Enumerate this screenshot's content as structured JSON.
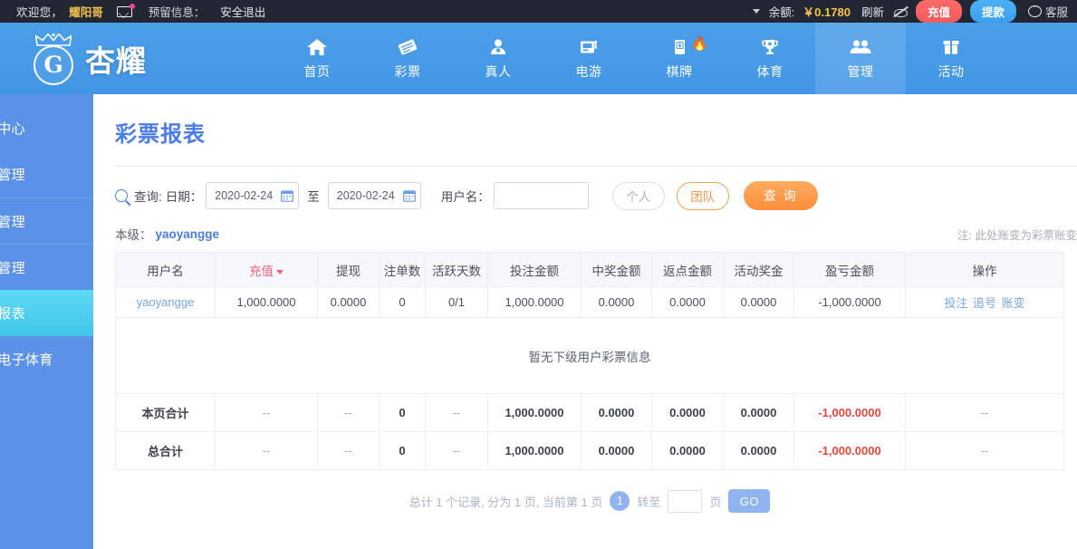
{
  "topbar": {
    "welcome": "欢迎您，",
    "user_name": "耀阳哥",
    "mail_icon": "mail-icon",
    "reserve_label": "预留信息：",
    "logout": "安全退出",
    "balance_label": "余额:",
    "balance_value": "￥0.1780",
    "refresh": "刷新",
    "eye_icon": "eye-off-icon",
    "recharge": "充值",
    "withdraw": "提款",
    "service": "客服",
    "accent_gold": "#f5c542",
    "accent_red": "#f35b5b",
    "accent_blue": "#3aa0ef"
  },
  "brand": {
    "logo_text": "杏耀",
    "logo_letter": "G"
  },
  "nav": {
    "items": [
      {
        "label": "首页",
        "icon": "home-icon",
        "active": false
      },
      {
        "label": "彩票",
        "icon": "ticket-icon",
        "active": false
      },
      {
        "label": "真人",
        "icon": "person-icon",
        "active": false
      },
      {
        "label": "电游",
        "icon": "slot-machine-icon",
        "active": false
      },
      {
        "label": "棋牌",
        "icon": "mahjong-tile-icon",
        "active": false,
        "badge": "fire-icon"
      },
      {
        "label": "体育",
        "icon": "trophy-icon",
        "active": false
      },
      {
        "label": "管理",
        "icon": "users-icon",
        "active": true
      },
      {
        "label": "活动",
        "icon": "gift-icon",
        "active": false
      }
    ]
  },
  "sidebar": {
    "items": [
      {
        "label": "理中心",
        "active": false,
        "divider": false
      },
      {
        "label": "人管理",
        "active": false,
        "divider": false
      },
      {
        "label": "人管理",
        "active": false,
        "divider": true
      },
      {
        "label": "表管理",
        "active": false,
        "divider": true
      },
      {
        "label": "票报表",
        "active": true,
        "divider": false
      },
      {
        "label": "人电子体育",
        "active": false,
        "divider": false
      }
    ]
  },
  "page": {
    "title": "彩票报表"
  },
  "filter": {
    "search_icon": "search-icon",
    "query_label": "查询:",
    "date_label": "日期：",
    "date_from": "2020-02-24",
    "date_to": "2020-02-24",
    "between": "至",
    "calendar_icon": "calendar-icon",
    "username_label": "用户名：",
    "username_value": "",
    "username_placeholder": "",
    "personal_btn": "个人",
    "team_btn": "团队",
    "query_btn": "查 询"
  },
  "level": {
    "label": "本级：",
    "value": "yaoyangge",
    "note": "注: 此处账变为彩票账变"
  },
  "table": {
    "headers": [
      {
        "label": "用户名",
        "sorted": false
      },
      {
        "label": "充值",
        "sorted": true
      },
      {
        "label": "提现",
        "sorted": false
      },
      {
        "label": "注单数",
        "sorted": false
      },
      {
        "label": "活跃天数",
        "sorted": false
      },
      {
        "label": "投注金额",
        "sorted": false
      },
      {
        "label": "中奖金额",
        "sorted": false
      },
      {
        "label": "返点金额",
        "sorted": false
      },
      {
        "label": "活动奖金",
        "sorted": false
      },
      {
        "label": "盈亏金额",
        "sorted": false
      },
      {
        "label": "操作",
        "sorted": false
      }
    ],
    "rows": [
      {
        "username": "yaoyangge",
        "recharge": "1,000.0000",
        "withdraw": "0.0000",
        "bet_count": "0",
        "active_days": "0/1",
        "bet_amount": "1,000.0000",
        "win_amount": "0.0000",
        "rebate": "0.0000",
        "bonus": "0.0000",
        "profit": "-1,000.0000",
        "ops": [
          "投注",
          "追号",
          "账变"
        ]
      }
    ],
    "empty_text": "暂无下级用户彩票信息",
    "summary": [
      {
        "label": "本页合计",
        "recharge": "--",
        "withdraw": "--",
        "bet_count": "0",
        "active_days": "--",
        "bet_amount": "1,000.0000",
        "win_amount": "0.0000",
        "rebate": "0.0000",
        "bonus": "0.0000",
        "profit": "-1,000.0000",
        "ops": "--"
      },
      {
        "label": "总合计",
        "recharge": "--",
        "withdraw": "--",
        "bet_count": "0",
        "active_days": "--",
        "bet_amount": "1,000.0000",
        "win_amount": "0.0000",
        "rebate": "0.0000",
        "bonus": "0.0000",
        "profit": "-1,000.0000",
        "ops": "--"
      }
    ]
  },
  "pager": {
    "summary": "总计 1 个记录, 分为 1 页, 当前第 1 页",
    "current_page": "1",
    "jump_label": "转至",
    "jump_value": "",
    "page_unit": "页",
    "go_btn": "GO"
  }
}
